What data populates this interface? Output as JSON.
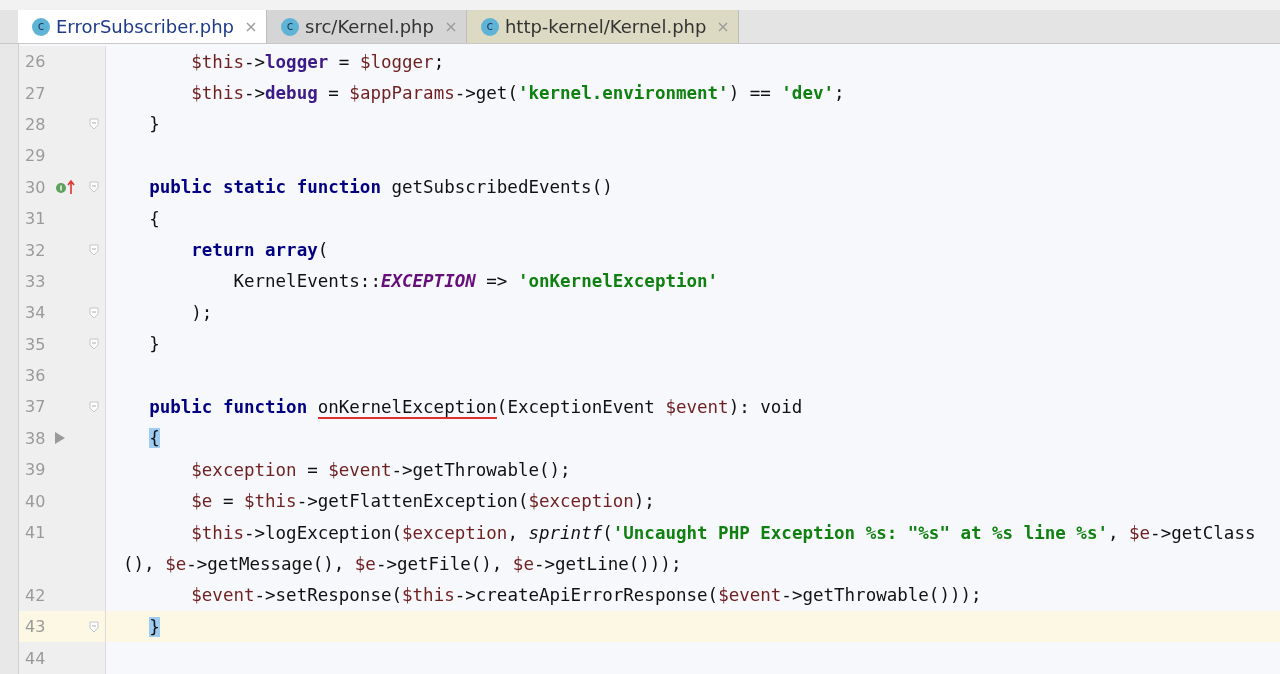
{
  "tabs": [
    {
      "icon_letter": "c",
      "label": "ErrorSubscriber.php",
      "selected": true
    },
    {
      "icon_letter": "c",
      "label": "src/Kernel.php",
      "selected": false
    },
    {
      "icon_letter": "c",
      "label": "http-kernel/Kernel.php",
      "selected": false,
      "color": "#dcdac2"
    }
  ],
  "lines": [
    {
      "number": "26",
      "fold": false,
      "current": false,
      "tokens": [
        {
          "kind": "var",
          "text": "        $this"
        },
        {
          "kind": "plain",
          "text": "->"
        },
        {
          "kind": "field",
          "text": "logger"
        },
        {
          "kind": "plain",
          "text": " = "
        },
        {
          "kind": "var",
          "text": "$logger"
        },
        {
          "kind": "plain",
          "text": ";"
        }
      ]
    },
    {
      "number": "27",
      "fold": false,
      "current": false,
      "tokens": [
        {
          "kind": "var",
          "text": "        $this"
        },
        {
          "kind": "plain",
          "text": "->"
        },
        {
          "kind": "field",
          "text": "debug"
        },
        {
          "kind": "plain",
          "text": " = "
        },
        {
          "kind": "var",
          "text": "$appParams"
        },
        {
          "kind": "plain",
          "text": "->get("
        },
        {
          "kind": "string",
          "text": "'kernel.environment'"
        },
        {
          "kind": "plain",
          "text": ") == "
        },
        {
          "kind": "string",
          "text": "'dev'"
        },
        {
          "kind": "plain",
          "text": ";"
        }
      ]
    },
    {
      "number": "28",
      "fold": true,
      "current": false,
      "tokens": [
        {
          "kind": "plain",
          "text": "    }"
        }
      ]
    },
    {
      "number": "29",
      "fold": false,
      "current": false
    },
    {
      "number": "30",
      "fold": true,
      "current": false,
      "gutter_mark": {
        "kind": "implements"
      },
      "tokens": [
        {
          "kind": "keyword",
          "text": "    public static function"
        },
        {
          "kind": "plain",
          "text": " getSubscribedEvents()"
        }
      ]
    },
    {
      "number": "31",
      "fold": false,
      "current": false,
      "tokens": [
        {
          "kind": "plain",
          "text": "    {"
        }
      ]
    },
    {
      "number": "32",
      "fold": true,
      "current": false,
      "tokens": [
        {
          "kind": "keyword",
          "text": "        return array"
        },
        {
          "kind": "plain",
          "text": "("
        }
      ]
    },
    {
      "number": "33",
      "fold": false,
      "current": false,
      "tokens": [
        {
          "kind": "plain",
          "text": "            KernelEvents::"
        },
        {
          "kind": "constant",
          "text": "EXCEPTION"
        },
        {
          "kind": "plain",
          "text": " => "
        },
        {
          "kind": "string",
          "text": "'onKernelException'"
        }
      ]
    },
    {
      "number": "34",
      "fold": true,
      "current": false,
      "tokens": [
        {
          "kind": "plain",
          "text": "        );"
        }
      ]
    },
    {
      "number": "35",
      "fold": true,
      "current": false,
      "tokens": [
        {
          "kind": "plain",
          "text": "    }"
        }
      ]
    },
    {
      "number": "36",
      "fold": false,
      "current": false
    },
    {
      "number": "37",
      "fold": true,
      "current": false,
      "tokens": [
        {
          "kind": "keyword",
          "text": "    public function "
        },
        {
          "kind": "error",
          "text": "onKernelException"
        },
        {
          "kind": "plain",
          "text": "(ExceptionEvent "
        },
        {
          "kind": "var",
          "text": "$event"
        },
        {
          "kind": "plain",
          "text": "): void"
        }
      ]
    },
    {
      "number": "38",
      "fold": false,
      "current": false,
      "gutter_mark": {
        "kind": "arrow"
      },
      "tokens": [
        {
          "kind": "match",
          "text": "    {"
        }
      ]
    },
    {
      "number": "39",
      "fold": false,
      "current": false,
      "tokens": [
        {
          "kind": "var",
          "text": "        $exception"
        },
        {
          "kind": "plain",
          "text": " = "
        },
        {
          "kind": "var",
          "text": "$event"
        },
        {
          "kind": "plain",
          "text": "->getThrowable();"
        }
      ]
    },
    {
      "number": "40",
      "fold": false,
      "current": false,
      "tokens": [
        {
          "kind": "var",
          "text": "        $e"
        },
        {
          "kind": "plain",
          "text": " = "
        },
        {
          "kind": "var",
          "text": "$this"
        },
        {
          "kind": "plain",
          "text": "->getFlattenException("
        },
        {
          "kind": "var",
          "text": "$exception"
        },
        {
          "kind": "plain",
          "text": ");"
        }
      ]
    },
    {
      "number": "41",
      "fold": false,
      "current": false,
      "tokens": [
        {
          "kind": "var",
          "text": "        $this"
        },
        {
          "kind": "plain",
          "text": "->logException("
        },
        {
          "kind": "var",
          "text": "$exception"
        },
        {
          "kind": "plain",
          "text": ", "
        },
        {
          "kind": "call",
          "text": "sprintf"
        },
        {
          "kind": "plain",
          "text": "("
        },
        {
          "kind": "string",
          "text": "'Uncaught PHP Exception %s: \"%s\" at %s line %s'"
        },
        {
          "kind": "plain",
          "text": ", "
        },
        {
          "kind": "var",
          "text": "$e"
        },
        {
          "kind": "plain",
          "text": "->getClass"
        }
      ]
    },
    {
      "fold": false,
      "current": false,
      "tokens": [
        {
          "kind": "plain",
          "text": "(), "
        },
        {
          "kind": "var",
          "text": "$e"
        },
        {
          "kind": "plain",
          "text": "->getMessage(), "
        },
        {
          "kind": "var",
          "text": "$e"
        },
        {
          "kind": "plain",
          "text": "->getFile(), "
        },
        {
          "kind": "var",
          "text": "$e"
        },
        {
          "kind": "plain",
          "text": "->getLine()));"
        }
      ]
    },
    {
      "number": "42",
      "fold": false,
      "current": false,
      "tokens": [
        {
          "kind": "var",
          "text": "        $event"
        },
        {
          "kind": "plain",
          "text": "->setResponse("
        },
        {
          "kind": "var",
          "text": "$this"
        },
        {
          "kind": "plain",
          "text": "->createApiErrorResponse("
        },
        {
          "kind": "var",
          "text": "$event"
        },
        {
          "kind": "plain",
          "text": "->getThrowable()));"
        }
      ]
    },
    {
      "number": "43",
      "fold": true,
      "current": true,
      "tokens": [
        {
          "kind": "match",
          "text": "    }"
        }
      ]
    },
    {
      "number": "44",
      "fold": false,
      "current": false
    }
  ]
}
